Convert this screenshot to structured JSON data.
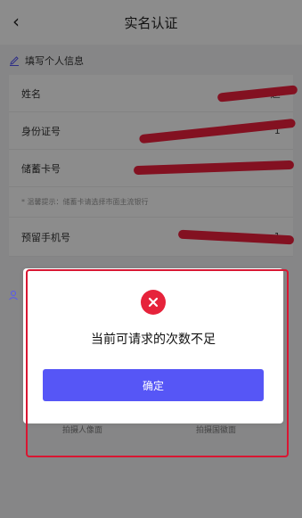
{
  "header": {
    "title": "实名认证",
    "back_icon": "chevron-left-icon"
  },
  "section": {
    "title": "填写个人信息",
    "icon": "pencil-icon"
  },
  "form": {
    "name_label": "姓名",
    "name_value": "赵",
    "id_label": "身份证号",
    "id_value": "1",
    "bankcard_label": "储蓄卡号",
    "hint": "* 温馨提示：储蓄卡请选择市面主流银行",
    "phone_label": "预留手机号",
    "phone_value": "1"
  },
  "dialog": {
    "icon": "close-circle-icon",
    "message": "当前可请求的次数不足",
    "confirm_label": "确定"
  },
  "bottom": {
    "left_label": "拍摄人像面",
    "right_label": "拍摄国徽面"
  },
  "colors": {
    "primary_button": "#5656f6",
    "error": "#e6233b",
    "annotation_red": "#d91632",
    "redaction_red": "#ee1f3d",
    "overlay": "rgba(0,0,0,0.45)"
  }
}
